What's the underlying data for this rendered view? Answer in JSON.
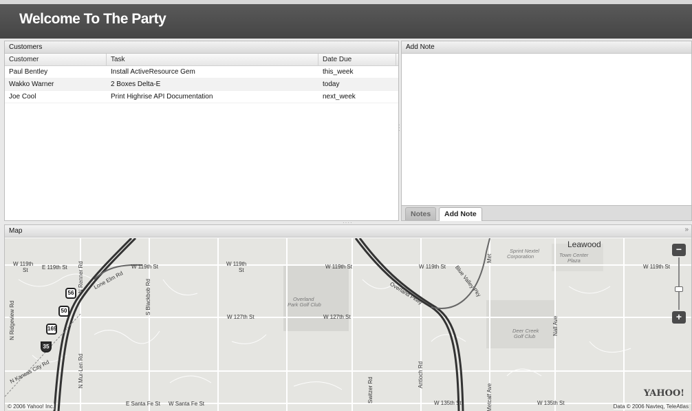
{
  "header": {
    "title": "Welcome To The Party"
  },
  "customers": {
    "title": "Customers",
    "columns": [
      "Customer",
      "Task",
      "Date Due"
    ],
    "rows": [
      [
        "Paul Bentley",
        "Install ActiveResource Gem",
        "this_week"
      ],
      [
        "Wakko Warner",
        "2 Boxes Delta-E",
        "today"
      ],
      [
        "Joe Cool",
        "Print Highrise API Documentation",
        "next_week"
      ]
    ]
  },
  "add_note": {
    "title": "Add Note",
    "tabs": [
      {
        "label": "Notes",
        "active": false
      },
      {
        "label": "Add Note",
        "active": true
      }
    ]
  },
  "map_panel": {
    "title": "Map",
    "labels": {
      "w119_1": "W 119th",
      "w119_1b": "St",
      "e119": "E 119th St",
      "w119_2": "W 119th St",
      "w119_3": "W 119th",
      "w119_3b": "St",
      "w119_4": "W 119th St",
      "w119_5": "W 119th St",
      "w119_6": "W 119th St",
      "renner": "N Renner Rd",
      "lone_elm": "Lone Elm Rd",
      "blackbob": "S Blackbob Rd",
      "ridgeview": "N Ridgeview Rd",
      "kansas_city": "N Kansas City Rd",
      "n_mur_len": "N Mur-Len Rd",
      "w127_1": "W 127th St",
      "w127_2": "W 127th St",
      "overland": "Overland",
      "overland2": "Park Golf Club",
      "overland_pkwy": "Overland Pkwy",
      "blue_valley": "Blue Valley Pky",
      "antioch": "Antioch Rd",
      "switzer": "Switzer Rd",
      "sprint1": "Sprint Nextel",
      "sprint2": "Corporation",
      "leawood": "Leawood",
      "town1": "Town Center",
      "town2": "Plaza",
      "deer1": "Deer Creek",
      "deer2": "Golf Club",
      "nall": "Nall Ave",
      "metcalf": "Metcalf Ave",
      "santafe": "E Santa Fe St",
      "wsantafe": "W Santa Fe St",
      "w135_1": "W 135th St",
      "w135_2": "W 135th St",
      "met": "Met"
    },
    "shields": [
      "56",
      "50",
      "169",
      "35"
    ],
    "brand": "YAHOO!",
    "copyright_left": "© 2006 Yahoo! Inc.",
    "copyright_right": "Data © 2006 Navteq, TeleAtlas",
    "zoom_out": "−",
    "zoom_in": "+"
  },
  "colors": {
    "header_bg": "#4d4d4d",
    "map_bg": "#e5e5e1",
    "road": "#ffffff",
    "highway": "#333333"
  }
}
